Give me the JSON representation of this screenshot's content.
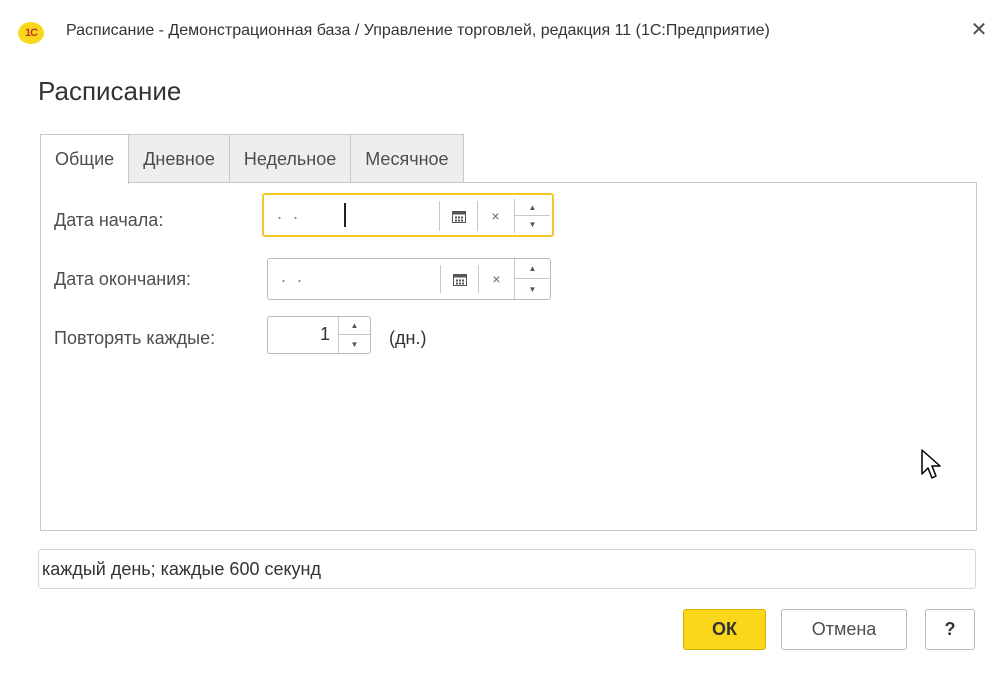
{
  "window": {
    "title": "Расписание - Демонстрационная база / Управление торговлей, редакция 11  (1С:Предприятие)",
    "logo_text": "1С",
    "close_symbol": "✕"
  },
  "form": {
    "title": "Расписание"
  },
  "tabs": [
    {
      "label": "Общие",
      "active": true
    },
    {
      "label": "Дневное",
      "active": false
    },
    {
      "label": "Недельное",
      "active": false
    },
    {
      "label": "Месячное",
      "active": false
    }
  ],
  "fields": {
    "start_date": {
      "label": "Дата начала:",
      "value": ". ."
    },
    "end_date": {
      "label": "Дата окончания:",
      "value": ". ."
    },
    "repeat": {
      "label": "Повторять каждые:",
      "value": "1",
      "unit": "(дн.)"
    }
  },
  "icons": {
    "calendar": "calendar-icon",
    "clear": "×",
    "spin_up": "▲",
    "spin_down": "▼"
  },
  "summary": {
    "text": "каждый день; каждые 600 секунд"
  },
  "buttons": {
    "ok": "ОК",
    "cancel": "Отмена",
    "help": "?"
  },
  "colors": {
    "accent": "#fbd71c",
    "focus_border": "#f5c52a"
  }
}
